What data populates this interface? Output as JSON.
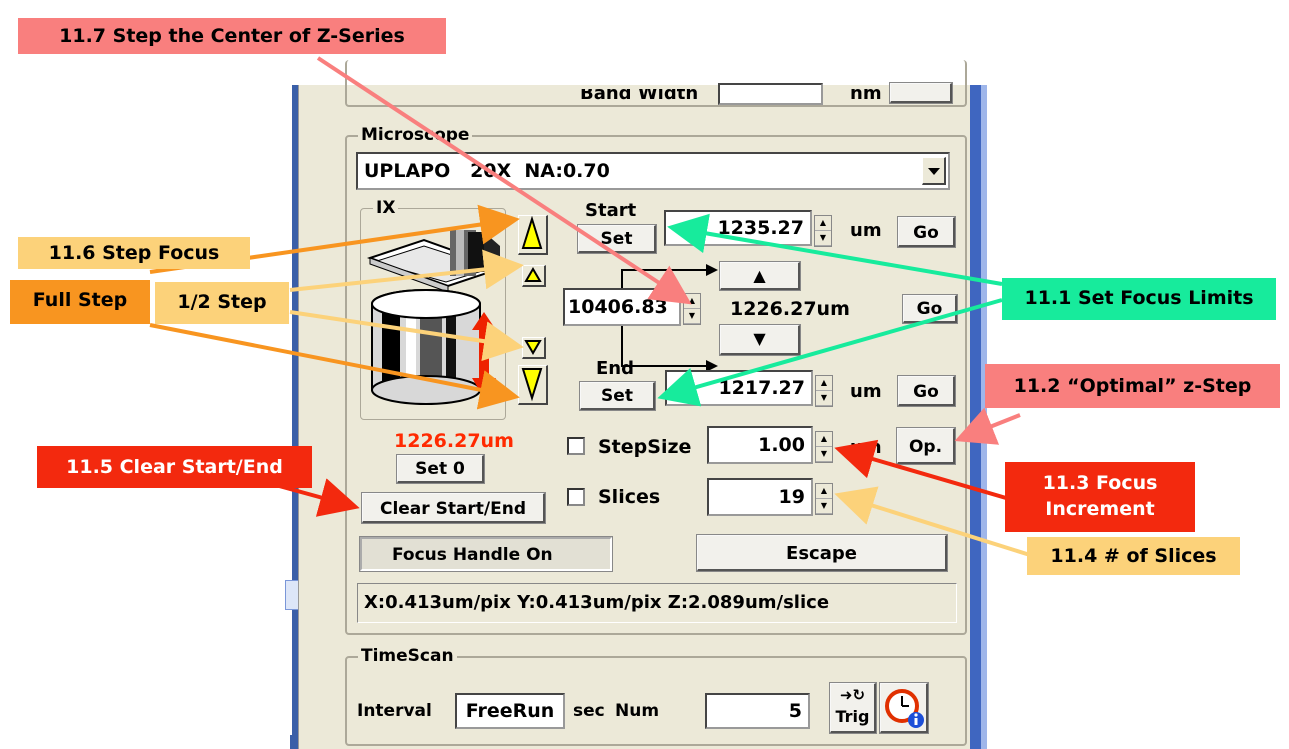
{
  "panel": {
    "band_width_label": "Band Width",
    "band_width_unit": "nm",
    "microscope": {
      "legend": "Microscope",
      "objective": "UPLAPO   20X  NA:0.70"
    },
    "ix": {
      "legend": "IX",
      "position": "1226.27um",
      "set0": "Set 0",
      "clear": "Clear Start/End",
      "focus_handle": "Focus Handle On"
    },
    "start": {
      "label": "Start",
      "set": "Set",
      "value": "1235.27",
      "unit": "um",
      "go": "Go"
    },
    "center": {
      "value": "10406.83",
      "position": "1226.27um",
      "go": "Go",
      "up": "▲",
      "down": "▼"
    },
    "end": {
      "label": "End",
      "set": "Set",
      "value": "1217.27",
      "unit": "um",
      "go": "Go"
    },
    "stepsize": {
      "label": "StepSize",
      "value": "1.00",
      "unit": "um",
      "op": "Op."
    },
    "slices": {
      "label": "Slices",
      "value": "19"
    },
    "escape": "Escape",
    "status": "X:0.413um/pix Y:0.413um/pix Z:2.089um/slice",
    "timescan": {
      "legend": "TimeScan",
      "interval_label": "Interval",
      "interval": "FreeRun",
      "sec": "sec",
      "num_label": "Num",
      "num": "5",
      "trig": "Trig"
    }
  },
  "annotations": {
    "a117": "11.7 Step the Center of Z-Series",
    "a116": "11.6 Step Focus",
    "full": "Full Step",
    "half": "1/2 Step",
    "a111": "11.1 Set Focus Limits",
    "a112": "11.2 “Optimal” z-Step",
    "a115": "11.5 Clear Start/End",
    "a113a": "11.3 Focus",
    "a113b": "Increment",
    "a114": "11.4 # of Slices"
  },
  "colors": {
    "salmon": "#f97f7e",
    "orange": "#f89520",
    "yellow": "#fcd27a",
    "green": "#17eb9c",
    "red": "#f3290e"
  }
}
